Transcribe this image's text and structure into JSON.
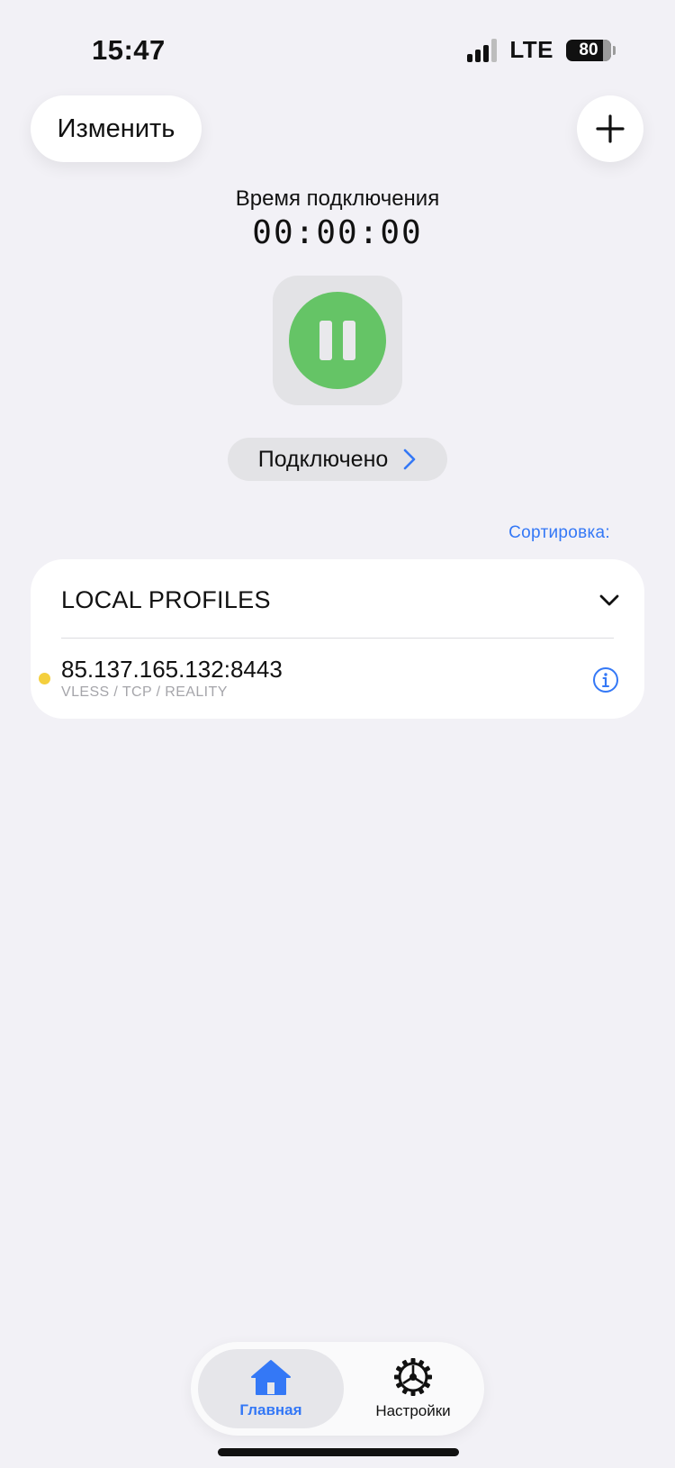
{
  "status_bar": {
    "time": "15:47",
    "network": "LTE",
    "battery": "80"
  },
  "header": {
    "edit_label": "Изменить",
    "add_icon": "plus-icon"
  },
  "connection": {
    "label": "Время подключения",
    "timer": "00:00:00",
    "status": "Подключено",
    "accent_color": "#65C466"
  },
  "sort": {
    "label": "Сортировка:"
  },
  "profiles": {
    "group_title": "LOCAL PROFILES",
    "items": [
      {
        "address": "85.137.165.132:8443",
        "protocol": "VLESS / TCP / REALITY",
        "status_color": "#F4CF3D"
      }
    ]
  },
  "tabbar": {
    "tabs": [
      {
        "label": "Главная",
        "icon": "house-icon",
        "active": true
      },
      {
        "label": "Настройки",
        "icon": "gear-icon",
        "active": false
      }
    ],
    "accent_color": "#3478F6"
  }
}
